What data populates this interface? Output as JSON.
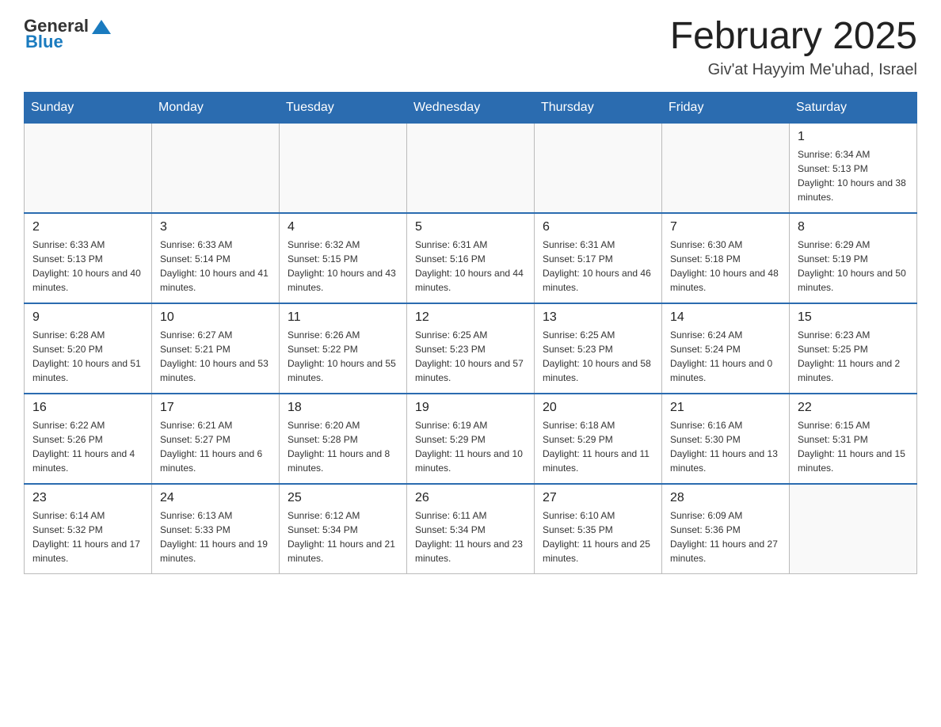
{
  "header": {
    "logo_general": "General",
    "logo_blue": "Blue",
    "title": "February 2025",
    "location": "Giv'at Hayyim Me'uhad, Israel"
  },
  "days_of_week": [
    "Sunday",
    "Monday",
    "Tuesday",
    "Wednesday",
    "Thursday",
    "Friday",
    "Saturday"
  ],
  "weeks": [
    [
      {
        "day": "",
        "info": ""
      },
      {
        "day": "",
        "info": ""
      },
      {
        "day": "",
        "info": ""
      },
      {
        "day": "",
        "info": ""
      },
      {
        "day": "",
        "info": ""
      },
      {
        "day": "",
        "info": ""
      },
      {
        "day": "1",
        "info": "Sunrise: 6:34 AM\nSunset: 5:13 PM\nDaylight: 10 hours and 38 minutes."
      }
    ],
    [
      {
        "day": "2",
        "info": "Sunrise: 6:33 AM\nSunset: 5:13 PM\nDaylight: 10 hours and 40 minutes."
      },
      {
        "day": "3",
        "info": "Sunrise: 6:33 AM\nSunset: 5:14 PM\nDaylight: 10 hours and 41 minutes."
      },
      {
        "day": "4",
        "info": "Sunrise: 6:32 AM\nSunset: 5:15 PM\nDaylight: 10 hours and 43 minutes."
      },
      {
        "day": "5",
        "info": "Sunrise: 6:31 AM\nSunset: 5:16 PM\nDaylight: 10 hours and 44 minutes."
      },
      {
        "day": "6",
        "info": "Sunrise: 6:31 AM\nSunset: 5:17 PM\nDaylight: 10 hours and 46 minutes."
      },
      {
        "day": "7",
        "info": "Sunrise: 6:30 AM\nSunset: 5:18 PM\nDaylight: 10 hours and 48 minutes."
      },
      {
        "day": "8",
        "info": "Sunrise: 6:29 AM\nSunset: 5:19 PM\nDaylight: 10 hours and 50 minutes."
      }
    ],
    [
      {
        "day": "9",
        "info": "Sunrise: 6:28 AM\nSunset: 5:20 PM\nDaylight: 10 hours and 51 minutes."
      },
      {
        "day": "10",
        "info": "Sunrise: 6:27 AM\nSunset: 5:21 PM\nDaylight: 10 hours and 53 minutes."
      },
      {
        "day": "11",
        "info": "Sunrise: 6:26 AM\nSunset: 5:22 PM\nDaylight: 10 hours and 55 minutes."
      },
      {
        "day": "12",
        "info": "Sunrise: 6:25 AM\nSunset: 5:23 PM\nDaylight: 10 hours and 57 minutes."
      },
      {
        "day": "13",
        "info": "Sunrise: 6:25 AM\nSunset: 5:23 PM\nDaylight: 10 hours and 58 minutes."
      },
      {
        "day": "14",
        "info": "Sunrise: 6:24 AM\nSunset: 5:24 PM\nDaylight: 11 hours and 0 minutes."
      },
      {
        "day": "15",
        "info": "Sunrise: 6:23 AM\nSunset: 5:25 PM\nDaylight: 11 hours and 2 minutes."
      }
    ],
    [
      {
        "day": "16",
        "info": "Sunrise: 6:22 AM\nSunset: 5:26 PM\nDaylight: 11 hours and 4 minutes."
      },
      {
        "day": "17",
        "info": "Sunrise: 6:21 AM\nSunset: 5:27 PM\nDaylight: 11 hours and 6 minutes."
      },
      {
        "day": "18",
        "info": "Sunrise: 6:20 AM\nSunset: 5:28 PM\nDaylight: 11 hours and 8 minutes."
      },
      {
        "day": "19",
        "info": "Sunrise: 6:19 AM\nSunset: 5:29 PM\nDaylight: 11 hours and 10 minutes."
      },
      {
        "day": "20",
        "info": "Sunrise: 6:18 AM\nSunset: 5:29 PM\nDaylight: 11 hours and 11 minutes."
      },
      {
        "day": "21",
        "info": "Sunrise: 6:16 AM\nSunset: 5:30 PM\nDaylight: 11 hours and 13 minutes."
      },
      {
        "day": "22",
        "info": "Sunrise: 6:15 AM\nSunset: 5:31 PM\nDaylight: 11 hours and 15 minutes."
      }
    ],
    [
      {
        "day": "23",
        "info": "Sunrise: 6:14 AM\nSunset: 5:32 PM\nDaylight: 11 hours and 17 minutes."
      },
      {
        "day": "24",
        "info": "Sunrise: 6:13 AM\nSunset: 5:33 PM\nDaylight: 11 hours and 19 minutes."
      },
      {
        "day": "25",
        "info": "Sunrise: 6:12 AM\nSunset: 5:34 PM\nDaylight: 11 hours and 21 minutes."
      },
      {
        "day": "26",
        "info": "Sunrise: 6:11 AM\nSunset: 5:34 PM\nDaylight: 11 hours and 23 minutes."
      },
      {
        "day": "27",
        "info": "Sunrise: 6:10 AM\nSunset: 5:35 PM\nDaylight: 11 hours and 25 minutes."
      },
      {
        "day": "28",
        "info": "Sunrise: 6:09 AM\nSunset: 5:36 PM\nDaylight: 11 hours and 27 minutes."
      },
      {
        "day": "",
        "info": ""
      }
    ]
  ]
}
